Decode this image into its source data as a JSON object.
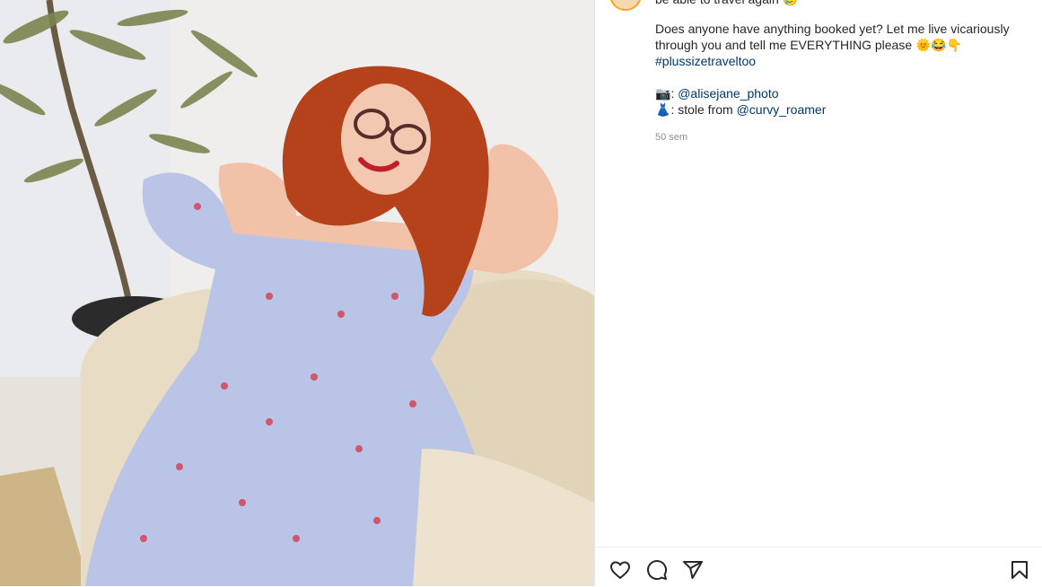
{
  "post": {
    "photo_alt": "Woman with curly red hair in a blue floral dress on a beige armchair",
    "caption_top": "be able to travel again 🥲",
    "caption_line1": "Does anyone have anything booked yet? Let me live vicariously through you and tell me EVERYTHING please 🌞😂👇",
    "hashtag": "#plussizetraveltoo",
    "credit_photo_emoji": "📷",
    "credit_photo_sep": ": ",
    "credit_photo_user": "@alisejane_photo",
    "credit_dress_emoji": "👗",
    "credit_dress_text": ": stole from ",
    "credit_dress_user": "@curvy_roamer",
    "time": "50 sem"
  },
  "icons": {
    "like": "heart-icon",
    "comment": "comment-icon",
    "share": "paper-plane-icon",
    "save": "bookmark-icon"
  }
}
